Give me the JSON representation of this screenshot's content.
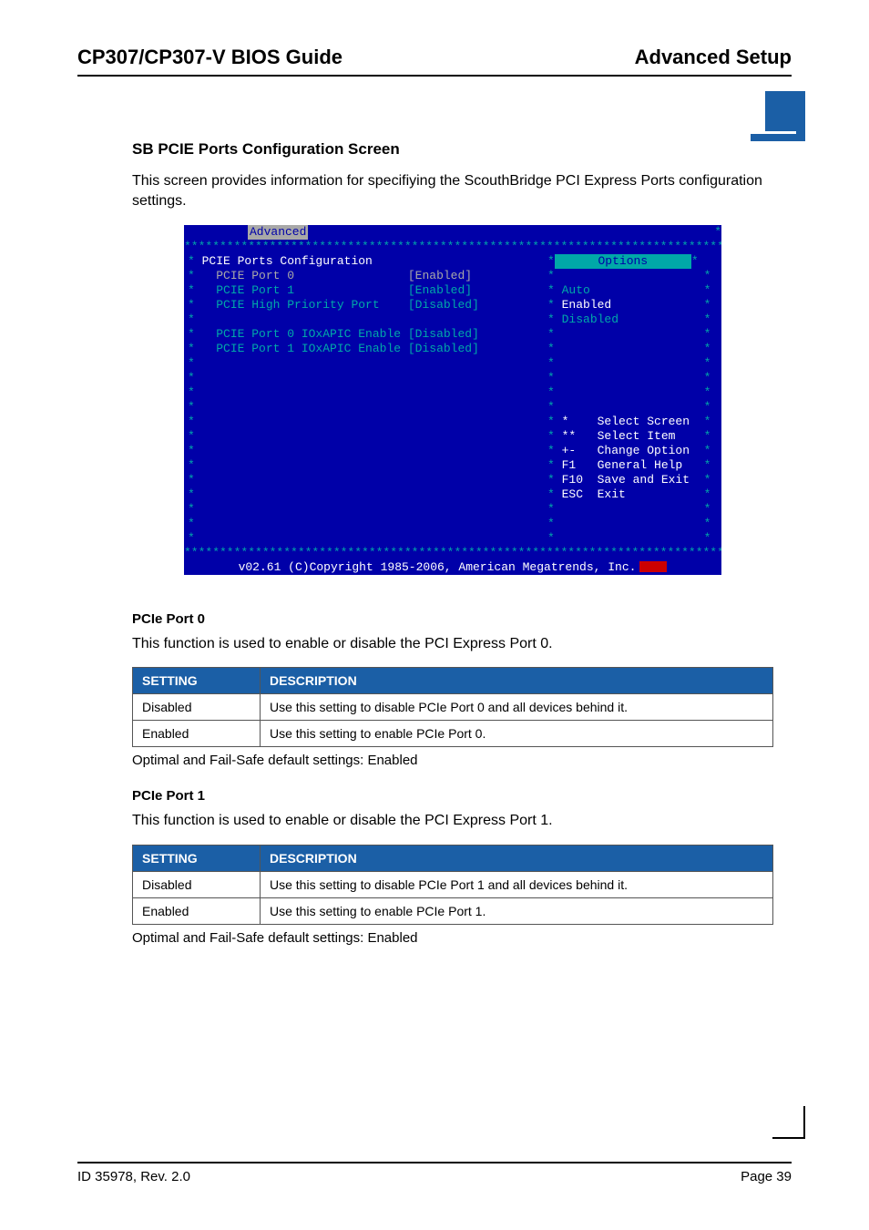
{
  "header": {
    "left": "CP307/CP307-V BIOS Guide",
    "right": "Advanced Setup"
  },
  "section": {
    "title": "SB PCIE Ports Configuration Screen",
    "intro": "This screen provides information for specifiying the ScouthBridge PCI Express Ports configuration settings."
  },
  "bios": {
    "tab": "Advanced",
    "border": "****************************************************************************",
    "left_lines": [
      {
        "star": "*",
        "text": " PCIE Ports Configuration",
        "val": "",
        "style": "white"
      },
      {
        "star": "*",
        "text": "   PCIE Port 0",
        "val": "[Enabled]",
        "style": "grey"
      },
      {
        "star": "*",
        "text": "   PCIE Port 1",
        "val": "[Enabled]",
        "style": "cyan"
      },
      {
        "star": "*",
        "text": "   PCIE High Priority Port",
        "val": "[Disabled]",
        "style": "cyan"
      },
      {
        "star": "*",
        "text": "",
        "val": "",
        "style": "cyan"
      },
      {
        "star": "*",
        "text": "   PCIE Port 0 IOxAPIC Enable",
        "val": "[Disabled]",
        "style": "cyan"
      },
      {
        "star": "*",
        "text": "   PCIE Port 1 IOxAPIC Enable",
        "val": "[Disabled]",
        "style": "cyan"
      },
      {
        "star": "*",
        "text": "",
        "val": "",
        "style": "cyan"
      },
      {
        "star": "*",
        "text": "",
        "val": "",
        "style": "cyan"
      },
      {
        "star": "*",
        "text": "",
        "val": "",
        "style": "cyan"
      },
      {
        "star": "*",
        "text": "",
        "val": "",
        "style": "cyan"
      },
      {
        "star": "*",
        "text": "",
        "val": "",
        "style": "cyan"
      },
      {
        "star": "*",
        "text": "",
        "val": "",
        "style": "cyan"
      },
      {
        "star": "*",
        "text": "",
        "val": "",
        "style": "cyan"
      },
      {
        "star": "*",
        "text": "",
        "val": "",
        "style": "cyan"
      },
      {
        "star": "*",
        "text": "",
        "val": "",
        "style": "cyan"
      },
      {
        "star": "*",
        "text": "",
        "val": "",
        "style": "cyan"
      },
      {
        "star": "*",
        "text": "",
        "val": "",
        "style": "cyan"
      },
      {
        "star": "*",
        "text": "",
        "val": "",
        "style": "cyan"
      },
      {
        "star": "*",
        "text": "",
        "val": "",
        "style": "cyan"
      }
    ],
    "right_lines": [
      {
        "pre": "*",
        "text": "Options",
        "post": "*",
        "style": "head"
      },
      {
        "pre": "*",
        "text": "",
        "post": "*",
        "style": "cyan"
      },
      {
        "pre": "*",
        "text": " Auto",
        "post": "*",
        "style": "cyan"
      },
      {
        "pre": "*",
        "text": " Enabled",
        "post": "*",
        "style": "white"
      },
      {
        "pre": "*",
        "text": " Disabled",
        "post": "*",
        "style": "cyan"
      },
      {
        "pre": "*",
        "text": "",
        "post": "*",
        "style": "cyan"
      },
      {
        "pre": "*",
        "text": "",
        "post": "*",
        "style": "cyan"
      },
      {
        "pre": "*",
        "text": "",
        "post": "*",
        "style": "cyan"
      },
      {
        "pre": "*",
        "text": "",
        "post": "*",
        "style": "cyan"
      },
      {
        "pre": "*",
        "text": "",
        "post": "*",
        "style": "cyan"
      },
      {
        "pre": "*",
        "text": "",
        "post": "*",
        "style": "cyan"
      },
      {
        "pre": "*",
        "text": " *    Select Screen",
        "post": "*",
        "style": "white"
      },
      {
        "pre": "*",
        "text": " **   Select Item",
        "post": "*",
        "style": "white"
      },
      {
        "pre": "*",
        "text": " +-   Change Option",
        "post": "*",
        "style": "white"
      },
      {
        "pre": "*",
        "text": " F1   General Help",
        "post": "*",
        "style": "white"
      },
      {
        "pre": "*",
        "text": " F10  Save and Exit",
        "post": "*",
        "style": "white"
      },
      {
        "pre": "*",
        "text": " ESC  Exit",
        "post": "*",
        "style": "white"
      },
      {
        "pre": "*",
        "text": "",
        "post": "*",
        "style": "cyan"
      },
      {
        "pre": "*",
        "text": "",
        "post": "*",
        "style": "cyan"
      },
      {
        "pre": "*",
        "text": "",
        "post": "*",
        "style": "cyan"
      }
    ],
    "footer": "v02.61 (C)Copyright 1985-2006, American Megatrends, Inc."
  },
  "pcie0": {
    "title": "PCIe Port 0",
    "desc": "This function is used to enable or disable the PCI Express Port 0.",
    "th_setting": "SETTING",
    "th_desc": "DESCRIPTION",
    "rows": [
      {
        "s": "Disabled",
        "d": "Use this setting to disable PCIe Port 0 and all devices behind it."
      },
      {
        "s": "Enabled",
        "d": "Use this setting to enable PCIe Port 0."
      }
    ],
    "defaults": "Optimal and Fail-Safe default settings: Enabled"
  },
  "pcie1": {
    "title": "PCIe Port 1",
    "desc": "This function is used to enable or disable the PCI Express Port 1.",
    "th_setting": "SETTING",
    "th_desc": "DESCRIPTION",
    "rows": [
      {
        "s": "Disabled",
        "d": "Use this setting to disable PCIe Port 1 and all devices behind it."
      },
      {
        "s": "Enabled",
        "d": "Use this setting to enable PCIe Port 1."
      }
    ],
    "defaults": "Optimal and Fail-Safe default settings: Enabled"
  },
  "footer": {
    "left": "ID 35978, Rev. 2.0",
    "right": "Page 39"
  }
}
